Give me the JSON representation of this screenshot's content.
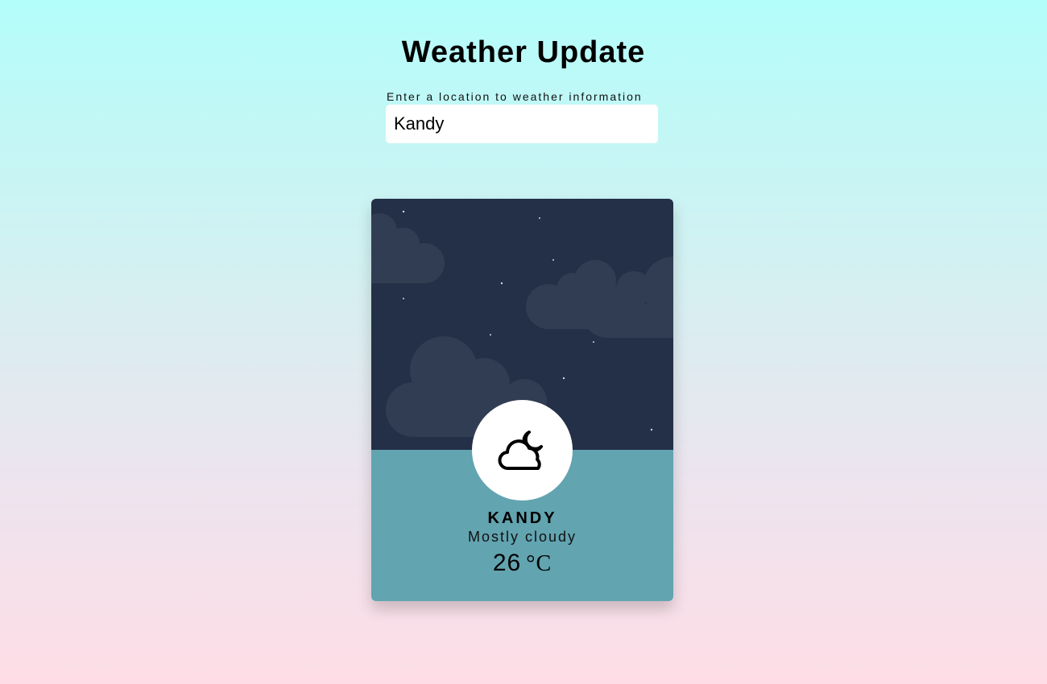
{
  "header": {
    "title": "Weather Update"
  },
  "search": {
    "label": "Enter a location to weather information",
    "value": "Kandy"
  },
  "weather": {
    "icon": "cloud-moon-icon",
    "city": "KANDY",
    "description": "Mostly cloudy",
    "temperature": "26",
    "unit": "°C"
  },
  "colors": {
    "sky": "#233047",
    "cloud": "#313d52",
    "moon": "#fde58f",
    "moon_shadow": "#f2c86a",
    "card_bottom": "#62a4b0",
    "bg_top": "#b3fdfa",
    "bg_bottom": "#fedde6"
  }
}
